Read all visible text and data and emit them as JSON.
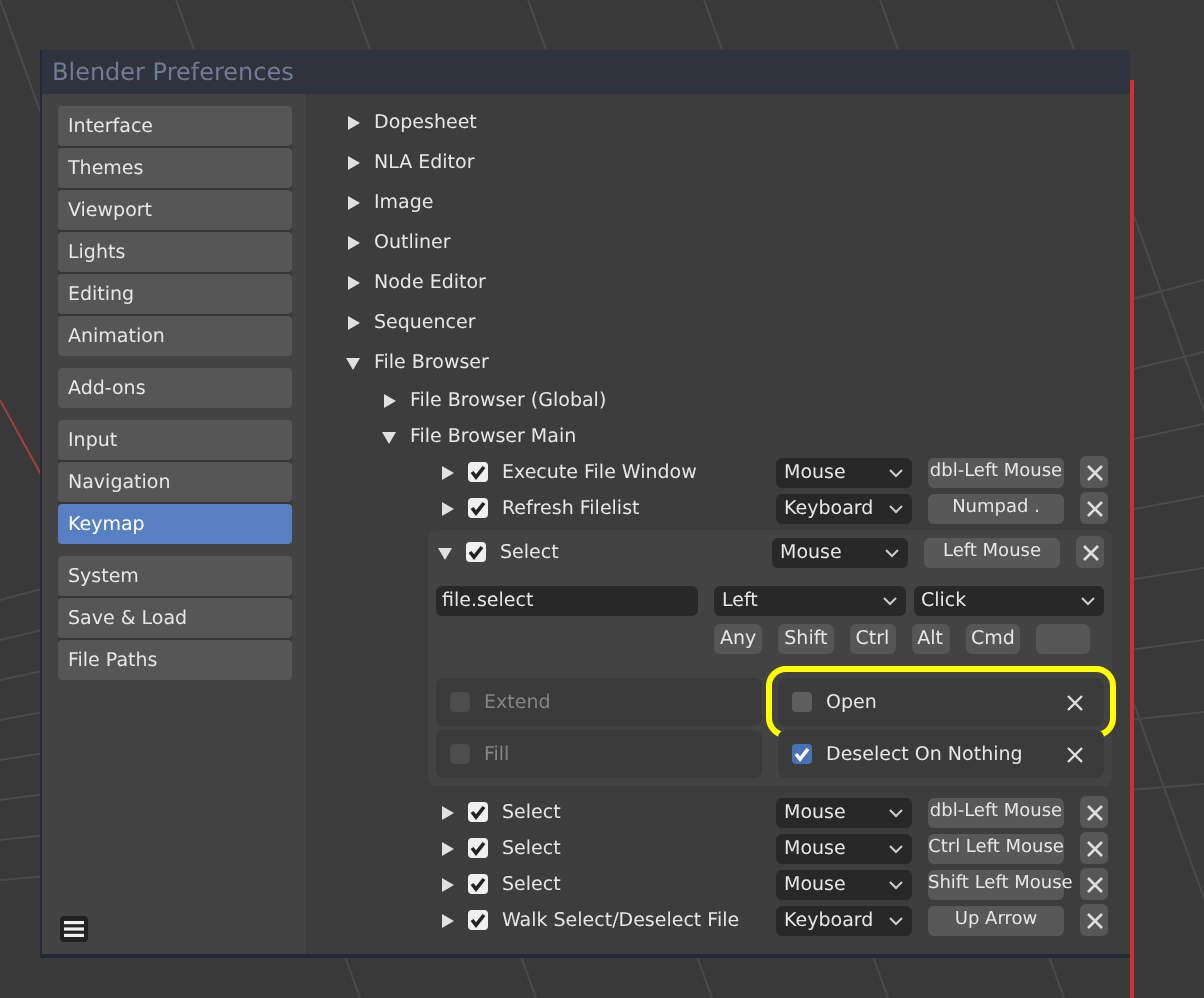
{
  "window": {
    "title": "Blender Preferences"
  },
  "sidebar": {
    "groups": [
      [
        {
          "label": "Interface",
          "selected": false
        },
        {
          "label": "Themes",
          "selected": false
        },
        {
          "label": "Viewport",
          "selected": false
        },
        {
          "label": "Lights",
          "selected": false
        },
        {
          "label": "Editing",
          "selected": false
        },
        {
          "label": "Animation",
          "selected": false
        }
      ],
      [
        {
          "label": "Add-ons",
          "selected": false
        }
      ],
      [
        {
          "label": "Input",
          "selected": false
        },
        {
          "label": "Navigation",
          "selected": false
        },
        {
          "label": "Keymap",
          "selected": true
        }
      ],
      [
        {
          "label": "System",
          "selected": false
        },
        {
          "label": "Save & Load",
          "selected": false
        },
        {
          "label": "File Paths",
          "selected": false
        }
      ]
    ]
  },
  "sections": [
    {
      "label": "Dopesheet",
      "expanded": false
    },
    {
      "label": "NLA Editor",
      "expanded": false
    },
    {
      "label": "Image",
      "expanded": false
    },
    {
      "label": "Outliner",
      "expanded": false
    },
    {
      "label": "Node Editor",
      "expanded": false
    },
    {
      "label": "Sequencer",
      "expanded": false
    },
    {
      "label": "File Browser",
      "expanded": true,
      "children": [
        {
          "label": "File Browser (Global)",
          "expanded": false
        },
        {
          "label": "File Browser Main",
          "expanded": true,
          "items": [
            {
              "name": "Execute File Window",
              "checked": true,
              "expanded": false,
              "input_type": "Mouse",
              "key": "dbl-Left Mouse"
            },
            {
              "name": "Refresh Filelist",
              "checked": true,
              "expanded": false,
              "input_type": "Keyboard",
              "key": "Numpad ."
            },
            {
              "name": "Select",
              "checked": true,
              "expanded": true,
              "input_type": "Mouse",
              "key": "Left Mouse",
              "details": {
                "operator": "file.select",
                "button": "Left",
                "event": "Click",
                "modifiers": [
                  {
                    "label": "Any",
                    "on": false
                  },
                  {
                    "label": "Shift",
                    "on": false
                  },
                  {
                    "label": "Ctrl",
                    "on": false
                  },
                  {
                    "label": "Alt",
                    "on": false
                  },
                  {
                    "label": "Cmd",
                    "on": false
                  }
                ],
                "properties": [
                  {
                    "label": "Extend",
                    "checked": false,
                    "disabled": true,
                    "highlighted": false
                  },
                  {
                    "label": "Open",
                    "checked": false,
                    "disabled": false,
                    "highlighted": true
                  },
                  {
                    "label": "Fill",
                    "checked": false,
                    "disabled": true,
                    "highlighted": false
                  },
                  {
                    "label": "Deselect On Nothing",
                    "checked": true,
                    "disabled": false,
                    "highlighted": false
                  }
                ]
              }
            },
            {
              "name": "Select",
              "checked": true,
              "expanded": false,
              "input_type": "Mouse",
              "key": "dbl-Left Mouse"
            },
            {
              "name": "Select",
              "checked": true,
              "expanded": false,
              "input_type": "Mouse",
              "key": "Ctrl Left Mouse"
            },
            {
              "name": "Select",
              "checked": true,
              "expanded": false,
              "input_type": "Mouse",
              "key": "Shift Left Mouse"
            },
            {
              "name": "Walk Select/Deselect File",
              "checked": true,
              "expanded": false,
              "input_type": "Keyboard",
              "key": "Up Arrow"
            }
          ]
        }
      ]
    }
  ]
}
